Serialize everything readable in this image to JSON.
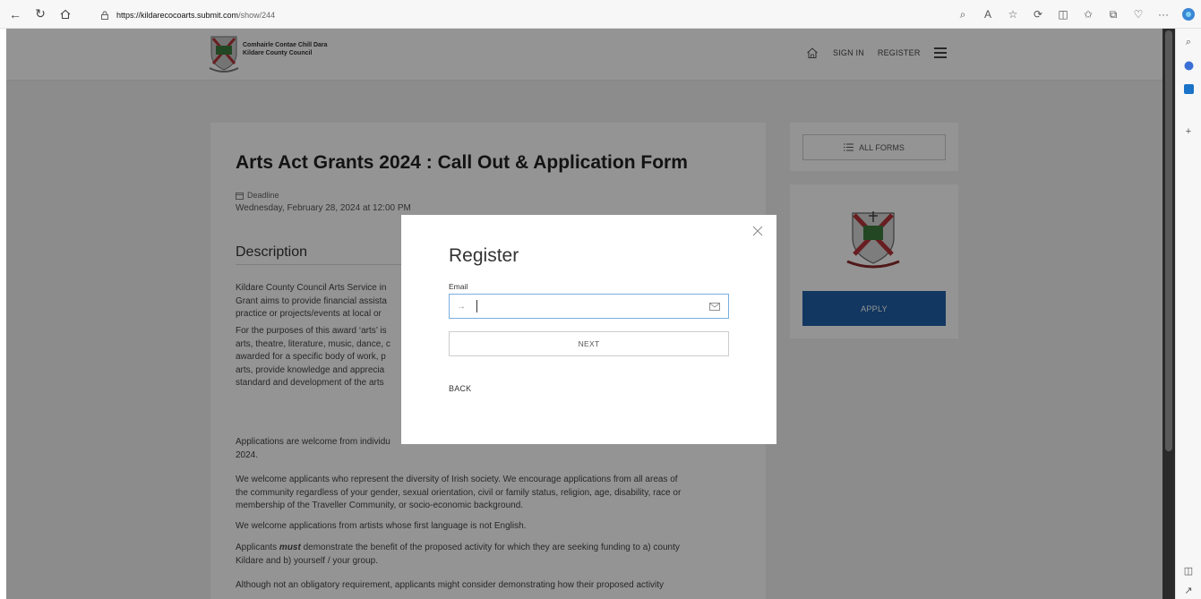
{
  "browser": {
    "url_host": "https://kildarecocoarts.submit.com",
    "url_path": "/show/244"
  },
  "header": {
    "logo_line1": "Comhairle Contae Chill Dara",
    "logo_line2": "Kildare County Council",
    "sign_in": "SIGN IN",
    "register": "REGISTER"
  },
  "main": {
    "title": "Arts Act Grants 2024 : Call Out & Application Form",
    "deadline_label": "Deadline",
    "deadline_value": "Wednesday, February 28, 2024 at 12:00 PM",
    "description_heading": "Description",
    "para1_line1": "Kildare County Council Arts Service in",
    "para1_line2": "Grant aims to provide financial assista",
    "para1_line3": "practice or projects/events at local or",
    "para2_line1": "For the purposes of this award ‘arts’ is",
    "para2_line2": "arts, theatre, literature, music, dance, c",
    "para2_line3": "awarded for a specific body of work, p",
    "para2_line4": "arts, provide knowledge and apprecia",
    "para2_line5": "standard and development of the arts",
    "para3_line1": "Applications are welcome from individu",
    "para3_line2": "2024.",
    "para4_line1": "We welcome applicants who represent the diversity of Irish society. We encourage applications from all areas of",
    "para4_line2": "the community regardless of your gender, sexual orientation, civil or family status, religion, age, disability, race or",
    "para4_line3": "membership of the Traveller Community, or socio-economic background.",
    "para5": "We welcome applications from artists whose first language is not English.",
    "para6_pre": "Applicants ",
    "para6_em": "must",
    "para6_post": " demonstrate the benefit of the proposed activity for which they are seeking funding to a) county",
    "para6_line2": "Kildare and b) yourself / your group.",
    "para7": "Although not an obligatory requirement, applicants might consider demonstrating how their proposed activity"
  },
  "sidebar": {
    "all_forms": "ALL FORMS",
    "apply": "APPLY"
  },
  "modal": {
    "title": "Register",
    "email_label": "Email",
    "email_value": "",
    "next": "NEXT",
    "back": "BACK"
  },
  "colors": {
    "apply_blue": "#1f5fa8",
    "input_focus_border": "#7aaee0"
  }
}
